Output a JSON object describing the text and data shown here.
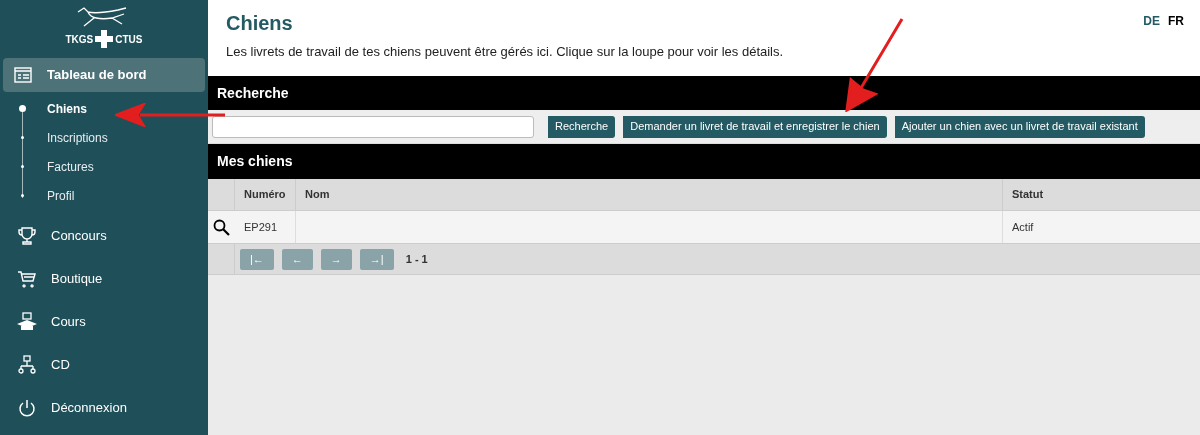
{
  "logo": {
    "left": "TKGS",
    "right": "CTUS"
  },
  "sidebar": {
    "items": [
      {
        "label": "Tableau de bord",
        "expanded": true,
        "children": [
          {
            "label": "Chiens",
            "selected": true
          },
          {
            "label": "Inscriptions",
            "selected": false
          },
          {
            "label": "Factures",
            "selected": false
          },
          {
            "label": "Profil",
            "selected": false
          }
        ]
      },
      {
        "label": "Concours",
        "expanded": false
      },
      {
        "label": "Boutique",
        "expanded": false
      },
      {
        "label": "Cours",
        "expanded": false
      },
      {
        "label": "CD",
        "expanded": false
      },
      {
        "label": "Déconnexion",
        "expanded": false
      }
    ]
  },
  "page": {
    "title": "Chiens",
    "description": "Les livrets de travail de tes chiens peuvent être gérés ici. Clique sur la loupe pour voir les détails."
  },
  "languages": [
    {
      "label": "DE",
      "selected": false
    },
    {
      "label": "FR",
      "selected": true
    }
  ],
  "search": {
    "heading": "Recherche",
    "buttons": [
      "Recherche",
      "Demander un livret de travail et enregistrer le chien",
      "Ajouter un chien avec un livret de travail existant"
    ]
  },
  "table": {
    "heading": "Mes chiens",
    "columns": [
      "Numéro",
      "Nom",
      "Statut"
    ],
    "rows": [
      [
        "EP291",
        "",
        "Actif"
      ]
    ],
    "pager": {
      "buttons": [
        "|←",
        "←",
        "→",
        "→|"
      ],
      "range": "1 - 1"
    }
  }
}
